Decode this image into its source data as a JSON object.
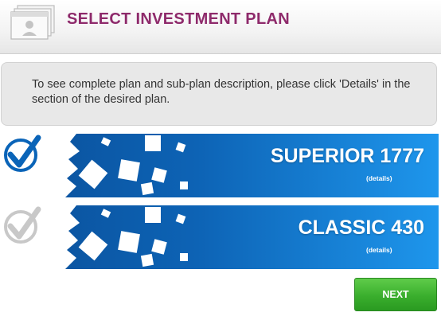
{
  "header": {
    "title": "SELECT INVESTMENT PLAN",
    "icon": "profile-window-icon"
  },
  "info": {
    "text": "To see complete plan and sub-plan description, please click 'Details' in the section of the desired plan."
  },
  "plans": [
    {
      "name": "SUPERIOR 1777",
      "details_label": "(details)",
      "selected": true
    },
    {
      "name": "CLASSIC 430",
      "details_label": "(details)",
      "selected": false
    }
  ],
  "actions": {
    "next_label": "NEXT"
  },
  "colors": {
    "title": "#8e2a6b",
    "banner_dark": "#0a5aa8",
    "banner_light": "#1e96ec",
    "next_button": "#3aae2d",
    "check_selected": "#0a64b8",
    "check_unselected": "#c8c8c8"
  }
}
